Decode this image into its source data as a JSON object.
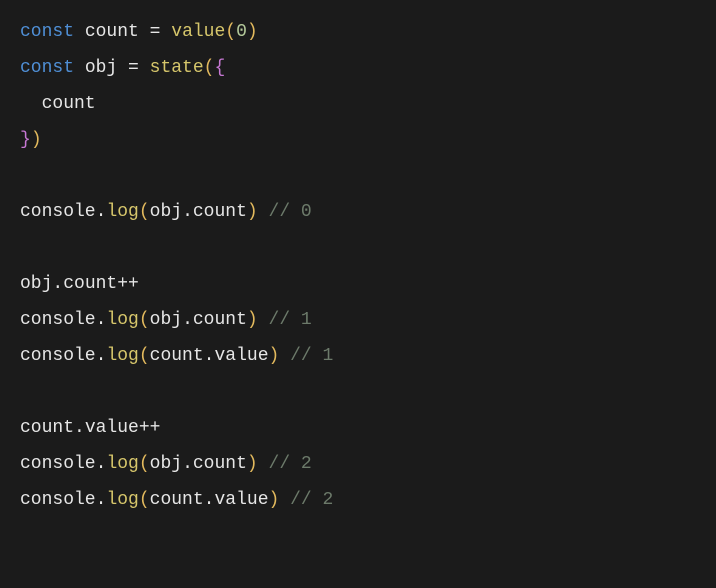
{
  "code": {
    "lines": [
      {
        "tokens": [
          {
            "cls": "kw",
            "t": "const"
          },
          {
            "cls": "id",
            "t": " count "
          },
          {
            "cls": "op",
            "t": "="
          },
          {
            "cls": "id",
            "t": " "
          },
          {
            "cls": "fn",
            "t": "value"
          },
          {
            "cls": "br",
            "t": "("
          },
          {
            "cls": "num",
            "t": "0"
          },
          {
            "cls": "br",
            "t": ")"
          }
        ]
      },
      {
        "tokens": [
          {
            "cls": "kw",
            "t": "const"
          },
          {
            "cls": "id",
            "t": " obj "
          },
          {
            "cls": "op",
            "t": "="
          },
          {
            "cls": "id",
            "t": " "
          },
          {
            "cls": "fn",
            "t": "state"
          },
          {
            "cls": "br",
            "t": "("
          },
          {
            "cls": "br2",
            "t": "{"
          }
        ]
      },
      {
        "tokens": [
          {
            "cls": "id",
            "t": "  count"
          }
        ]
      },
      {
        "tokens": [
          {
            "cls": "br2",
            "t": "}"
          },
          {
            "cls": "br",
            "t": ")"
          }
        ]
      },
      {
        "tokens": [
          {
            "cls": "id",
            "t": ""
          }
        ]
      },
      {
        "tokens": [
          {
            "cls": "id",
            "t": "console"
          },
          {
            "cls": "op",
            "t": "."
          },
          {
            "cls": "fn",
            "t": "log"
          },
          {
            "cls": "br",
            "t": "("
          },
          {
            "cls": "id",
            "t": "obj"
          },
          {
            "cls": "op",
            "t": "."
          },
          {
            "cls": "id",
            "t": "count"
          },
          {
            "cls": "br",
            "t": ")"
          },
          {
            "cls": "id",
            "t": " "
          },
          {
            "cls": "cm",
            "t": "// 0"
          }
        ]
      },
      {
        "tokens": [
          {
            "cls": "id",
            "t": ""
          }
        ]
      },
      {
        "tokens": [
          {
            "cls": "id",
            "t": "obj"
          },
          {
            "cls": "op",
            "t": "."
          },
          {
            "cls": "id",
            "t": "count"
          },
          {
            "cls": "op",
            "t": "++"
          }
        ]
      },
      {
        "tokens": [
          {
            "cls": "id",
            "t": "console"
          },
          {
            "cls": "op",
            "t": "."
          },
          {
            "cls": "fn",
            "t": "log"
          },
          {
            "cls": "br",
            "t": "("
          },
          {
            "cls": "id",
            "t": "obj"
          },
          {
            "cls": "op",
            "t": "."
          },
          {
            "cls": "id",
            "t": "count"
          },
          {
            "cls": "br",
            "t": ")"
          },
          {
            "cls": "id",
            "t": " "
          },
          {
            "cls": "cm",
            "t": "// 1"
          }
        ]
      },
      {
        "tokens": [
          {
            "cls": "id",
            "t": "console"
          },
          {
            "cls": "op",
            "t": "."
          },
          {
            "cls": "fn",
            "t": "log"
          },
          {
            "cls": "br",
            "t": "("
          },
          {
            "cls": "id",
            "t": "count"
          },
          {
            "cls": "op",
            "t": "."
          },
          {
            "cls": "id",
            "t": "value"
          },
          {
            "cls": "br",
            "t": ")"
          },
          {
            "cls": "id",
            "t": " "
          },
          {
            "cls": "cm",
            "t": "// 1"
          }
        ]
      },
      {
        "tokens": [
          {
            "cls": "id",
            "t": ""
          }
        ]
      },
      {
        "tokens": [
          {
            "cls": "id",
            "t": "count"
          },
          {
            "cls": "op",
            "t": "."
          },
          {
            "cls": "id",
            "t": "value"
          },
          {
            "cls": "op",
            "t": "++"
          }
        ]
      },
      {
        "tokens": [
          {
            "cls": "id",
            "t": "console"
          },
          {
            "cls": "op",
            "t": "."
          },
          {
            "cls": "fn",
            "t": "log"
          },
          {
            "cls": "br",
            "t": "("
          },
          {
            "cls": "id",
            "t": "obj"
          },
          {
            "cls": "op",
            "t": "."
          },
          {
            "cls": "id",
            "t": "count"
          },
          {
            "cls": "br",
            "t": ")"
          },
          {
            "cls": "id",
            "t": " "
          },
          {
            "cls": "cm",
            "t": "// 2"
          }
        ]
      },
      {
        "tokens": [
          {
            "cls": "id",
            "t": "console"
          },
          {
            "cls": "op",
            "t": "."
          },
          {
            "cls": "fn",
            "t": "log"
          },
          {
            "cls": "br",
            "t": "("
          },
          {
            "cls": "id",
            "t": "count"
          },
          {
            "cls": "op",
            "t": "."
          },
          {
            "cls": "id",
            "t": "value"
          },
          {
            "cls": "br",
            "t": ")"
          },
          {
            "cls": "id",
            "t": " "
          },
          {
            "cls": "cm",
            "t": "// 2"
          }
        ]
      }
    ]
  }
}
